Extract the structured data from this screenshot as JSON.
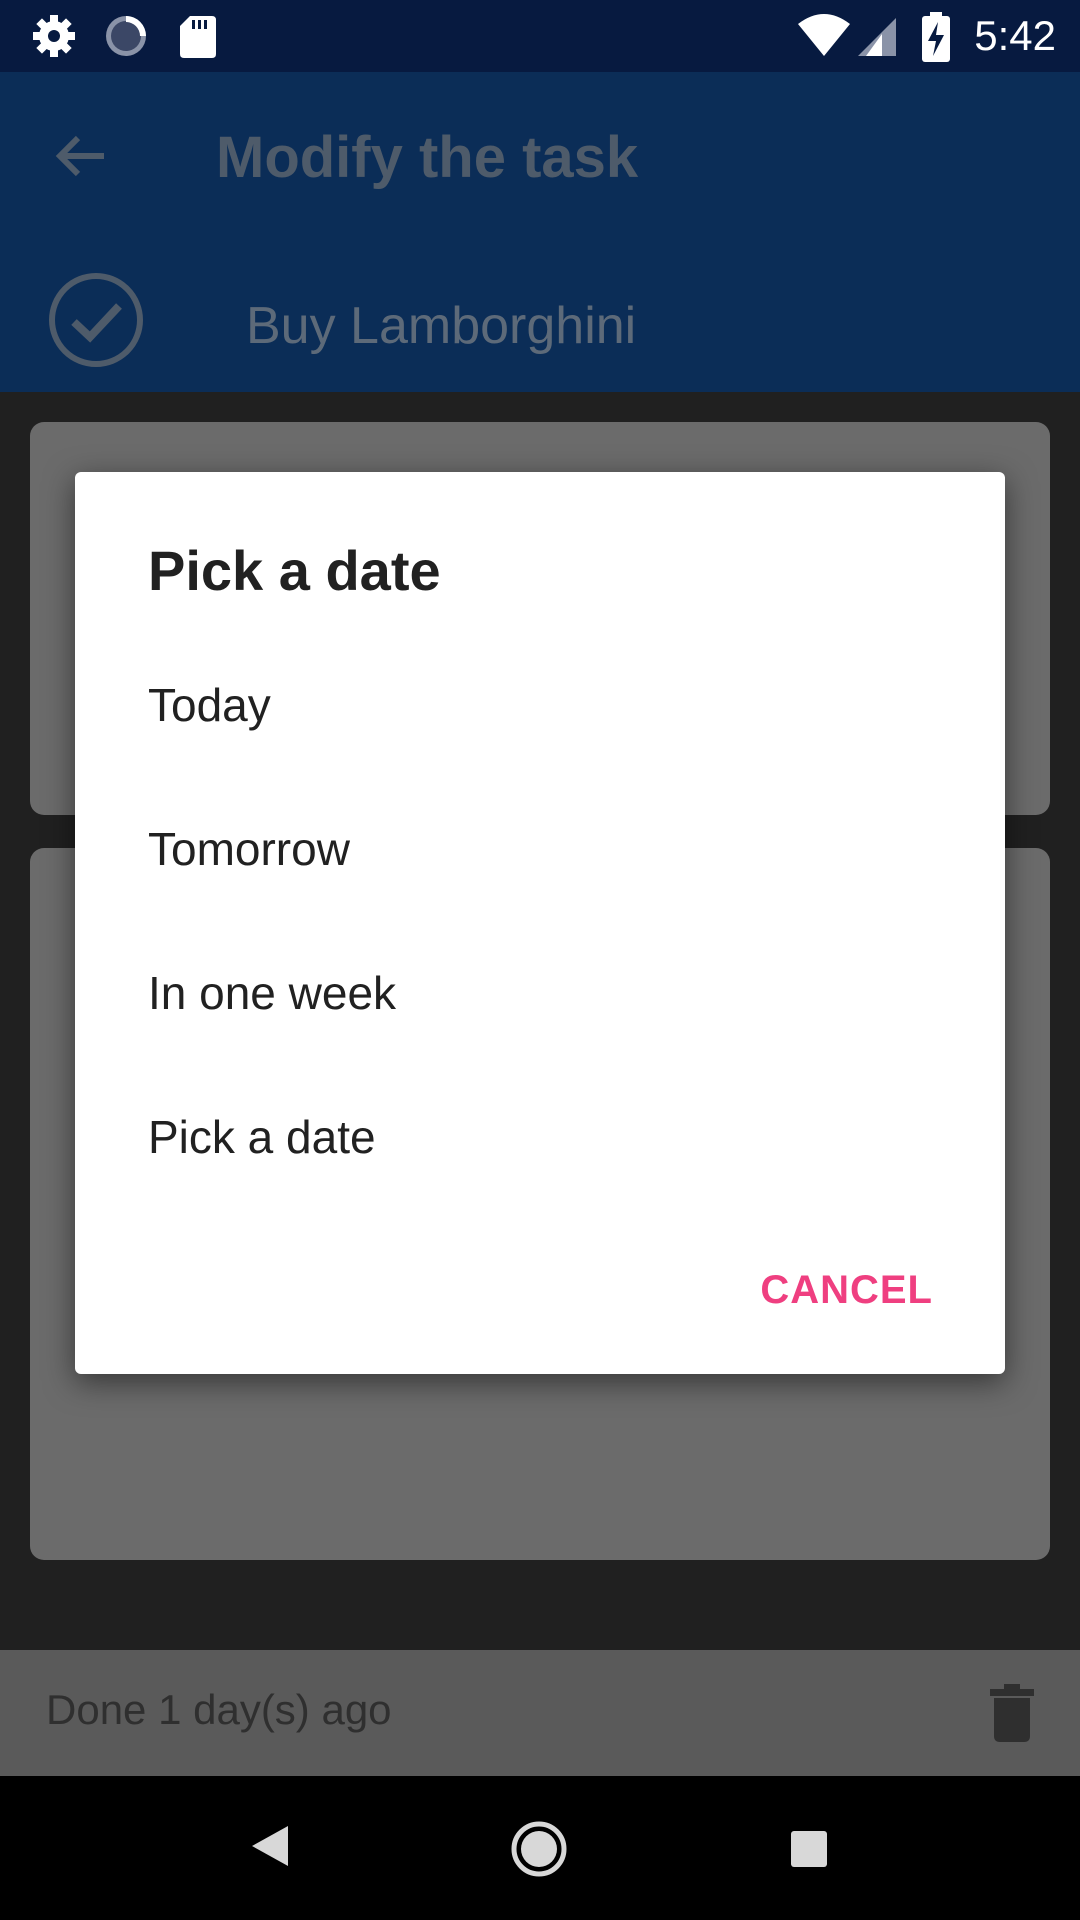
{
  "status_bar": {
    "time": "5:42",
    "icons": [
      "settings-icon",
      "sync-icon",
      "sd-card-icon",
      "wifi-icon",
      "signal-icon",
      "battery-charging-icon"
    ]
  },
  "app_bar": {
    "title": "Modify the task",
    "task_name": "Buy Lamborghini"
  },
  "bottom_bar": {
    "done_text": "Done 1 day(s) ago"
  },
  "dialog": {
    "title": "Pick a date",
    "options": [
      "Today",
      "Tomorrow",
      "In one week",
      "Pick a date"
    ],
    "cancel_label": "CANCEL",
    "accent_color": "#ef3f80"
  },
  "colors": {
    "status_bar": "#071a40",
    "app_bar": "#0b2d57"
  }
}
